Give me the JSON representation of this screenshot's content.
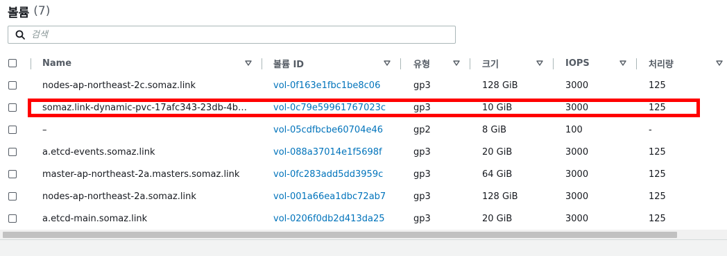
{
  "header": {
    "title": "볼륨",
    "count": "(7)"
  },
  "search": {
    "placeholder": "검색",
    "value": ""
  },
  "columns": [
    {
      "label": "Name"
    },
    {
      "label": "볼륨 ID"
    },
    {
      "label": "유형"
    },
    {
      "label": "크기"
    },
    {
      "label": "IOPS"
    },
    {
      "label": "처리량"
    }
  ],
  "rows": [
    {
      "name": "nodes-ap-northeast-2c.somaz.link",
      "volume_id": "vol-0f163e1fbc1be8c06",
      "type": "gp3",
      "size": "128 GiB",
      "iops": "3000",
      "throughput": "125"
    },
    {
      "name": "somaz.link-dynamic-pvc-17afc343-23db-4b…",
      "volume_id": "vol-0c79e59961767023c",
      "type": "gp3",
      "size": "10 GiB",
      "iops": "3000",
      "throughput": "125"
    },
    {
      "name": "–",
      "volume_id": "vol-05cdfbcbe60704e46",
      "type": "gp2",
      "size": "8 GiB",
      "iops": "100",
      "throughput": "-"
    },
    {
      "name": "a.etcd-events.somaz.link",
      "volume_id": "vol-088a37014e1f5698f",
      "type": "gp3",
      "size": "20 GiB",
      "iops": "3000",
      "throughput": "125"
    },
    {
      "name": "master-ap-northeast-2a.masters.somaz.link",
      "volume_id": "vol-0fc283add5dd3959c",
      "type": "gp3",
      "size": "64 GiB",
      "iops": "3000",
      "throughput": "125"
    },
    {
      "name": "nodes-ap-northeast-2a.somaz.link",
      "volume_id": "vol-001a66ea1dbc72ab7",
      "type": "gp3",
      "size": "128 GiB",
      "iops": "3000",
      "throughput": "125"
    },
    {
      "name": "a.etcd-main.somaz.link",
      "volume_id": "vol-0206f0db2d413da25",
      "type": "gp3",
      "size": "20 GiB",
      "iops": "3000",
      "throughput": "125"
    }
  ],
  "highlighted_row": 1,
  "colors": {
    "link": "#0073bb",
    "highlight": "#ff0000",
    "header_text": "#545b64"
  },
  "icons": {
    "search": "search-icon",
    "sort": "sort-caret-down-icon"
  }
}
